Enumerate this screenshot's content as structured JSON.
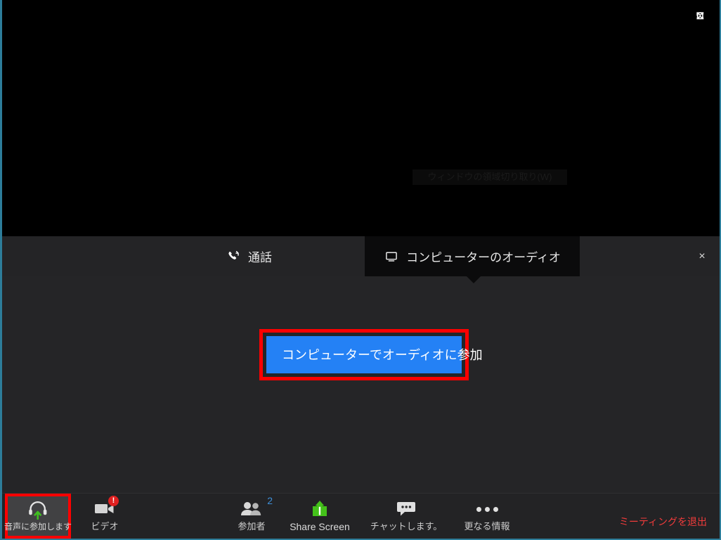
{
  "window": {
    "stage": {
      "fullscreen_icon": "fullscreen-expand-icon",
      "snip_overlay_text": "ウィンドウの領域切り取り(W)"
    }
  },
  "audio_dialog": {
    "tabs": [
      {
        "id": "call",
        "label": "通話",
        "icon": "phone-handset-icon",
        "active": false
      },
      {
        "id": "computer_audio",
        "label": "コンピューターのオーディオ",
        "icon": "monitor-icon",
        "active": true
      }
    ],
    "close_label": "×",
    "join_button_label": "コンピューターでオーディオに参加",
    "highlight_color": "#ff0000",
    "button_color": "#2481f5"
  },
  "toolbar": {
    "items": [
      {
        "id": "audio",
        "label": "音声に参加します",
        "icon": "headphones-join-audio-icon",
        "badge": "",
        "highlighted": true
      },
      {
        "id": "video",
        "label": "ビデオ",
        "icon": "video-camera-icon",
        "badge": "!",
        "highlighted": false
      },
      {
        "id": "participants",
        "label": "参加者",
        "icon": "participants-icon",
        "badge": "2",
        "highlighted": false
      },
      {
        "id": "share",
        "label": "Share Screen",
        "icon": "share-screen-icon",
        "badge": "",
        "highlighted": false
      },
      {
        "id": "chat",
        "label": "チャットします。",
        "icon": "chat-bubble-icon",
        "badge": "",
        "highlighted": false
      },
      {
        "id": "more",
        "label": "更なる情報",
        "icon": "more-dots-icon",
        "badge": "",
        "highlighted": false
      }
    ],
    "leave_label": "ミーティングを退出",
    "leave_color": "#f23b3b",
    "participants_count": "2",
    "video_badge": "!",
    "share_icon_color": "#44c21a",
    "audio_arrow_color": "#3fbf20"
  }
}
